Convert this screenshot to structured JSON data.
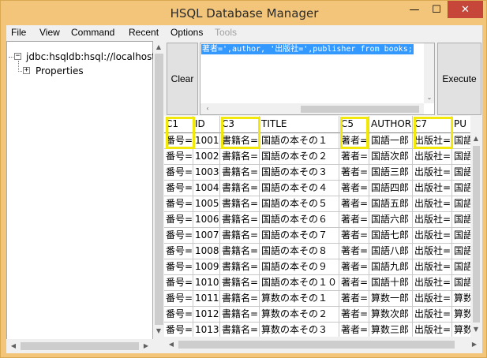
{
  "window": {
    "title": "HSQL Database Manager",
    "minimize": "—",
    "maximize": "☐",
    "close": "✕"
  },
  "menu": {
    "items": [
      "File",
      "View",
      "Command",
      "Recent",
      "Options",
      "Tools"
    ],
    "disabled": [
      "Tools"
    ]
  },
  "tree": {
    "root": "jdbc:hsqldb:hsql://localhost/",
    "child": "Properties",
    "root_expander": "−",
    "child_expander": "+"
  },
  "command": {
    "clear_label": "Clear",
    "execute_label": "Execute",
    "text": "著者=',author, '出版社=',publisher from books;"
  },
  "grid": {
    "columns": [
      "C1",
      "ID",
      "C3",
      "TITLE",
      "C5",
      "AUTHOR",
      "C7",
      "PU"
    ],
    "highlighted_columns": [
      "C1",
      "C3",
      "C5",
      "C7"
    ],
    "rows": [
      [
        "番号=",
        "1001",
        "書籍名=",
        "国語の本その１",
        "著者=",
        "国語一郎",
        "出版社=",
        "国語"
      ],
      [
        "番号=",
        "1002",
        "書籍名=",
        "国語の本その２",
        "著者=",
        "国語次郎",
        "出版社=",
        "国語"
      ],
      [
        "番号=",
        "1003",
        "書籍名=",
        "国語の本その３",
        "著者=",
        "国語三郎",
        "出版社=",
        "国語"
      ],
      [
        "番号=",
        "1004",
        "書籍名=",
        "国語の本その４",
        "著者=",
        "国語四郎",
        "出版社=",
        "国語"
      ],
      [
        "番号=",
        "1005",
        "書籍名=",
        "国語の本その５",
        "著者=",
        "国語五郎",
        "出版社=",
        "国語"
      ],
      [
        "番号=",
        "1006",
        "書籍名=",
        "国語の本その６",
        "著者=",
        "国語六郎",
        "出版社=",
        "国語"
      ],
      [
        "番号=",
        "1007",
        "書籍名=",
        "国語の本その７",
        "著者=",
        "国語七郎",
        "出版社=",
        "国語"
      ],
      [
        "番号=",
        "1008",
        "書籍名=",
        "国語の本その８",
        "著者=",
        "国語八郎",
        "出版社=",
        "国語"
      ],
      [
        "番号=",
        "1009",
        "書籍名=",
        "国語の本その９",
        "著者=",
        "国語九郎",
        "出版社=",
        "国語"
      ],
      [
        "番号=",
        "1010",
        "書籍名=",
        "国語の本その１０",
        "著者=",
        "国語十郎",
        "出版社=",
        "国語"
      ],
      [
        "番号=",
        "1011",
        "書籍名=",
        "算数の本その１",
        "著者=",
        "算数一郎",
        "出版社=",
        "算数"
      ],
      [
        "番号=",
        "1012",
        "書籍名=",
        "算数の本その２",
        "著者=",
        "算数次郎",
        "出版社=",
        "算数"
      ],
      [
        "番号=",
        "1013",
        "書籍名=",
        "算数の本その３",
        "著者=",
        "算数三郎",
        "出版社=",
        "算数"
      ]
    ]
  },
  "colors": {
    "highlight": "#f2e80c",
    "selection": "#3399ff",
    "window_frame": "#f3c57a"
  }
}
